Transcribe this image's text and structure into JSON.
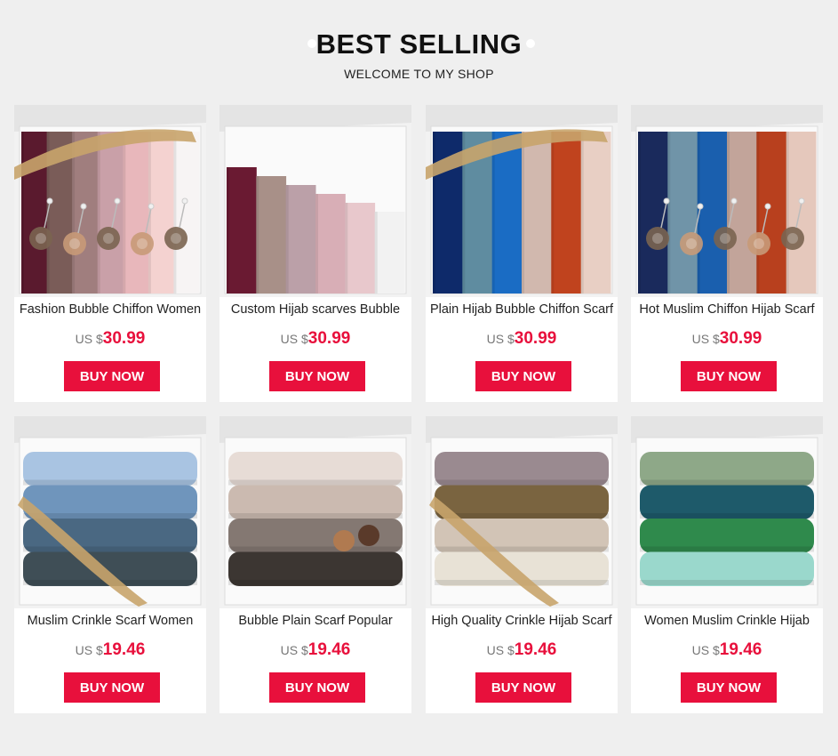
{
  "header": {
    "title": "BEST SELLING",
    "subtitle": "WELCOME TO MY SHOP"
  },
  "products": [
    {
      "name": "Fashion Bubble Chiffon Women",
      "currency": "US $",
      "price": "30.99",
      "buy_label": "BUY NOW",
      "image": "scarf-box-ribbon-roses",
      "colors": [
        "#5a1a2e",
        "#7a5c58",
        "#a07e7e",
        "#c9a0a8",
        "#e8b7bb",
        "#f4d2d0",
        "#f7f4f4"
      ]
    },
    {
      "name": "Custom Hijab scarves Bubble",
      "currency": "US $",
      "price": "30.99",
      "buy_label": "BUY NOW",
      "image": "scarf-box-folded",
      "colors": [
        "#6a1a32",
        "#a89088",
        "#bba0a8",
        "#d8aeb6",
        "#e8c8cc",
        "#f2f2f2"
      ]
    },
    {
      "name": "Plain Hijab Bubble Chiffon Scarf",
      "currency": "US $",
      "price": "30.99",
      "buy_label": "BUY NOW",
      "image": "scarf-box-ribbon",
      "colors": [
        "#0e2a6a",
        "#5f8ca0",
        "#1a6cc4",
        "#d1b8ae",
        "#c0431e",
        "#e8cfc4"
      ]
    },
    {
      "name": "Hot Muslim Chiffon Hijab Scarf",
      "currency": "US $",
      "price": "30.99",
      "buy_label": "BUY NOW",
      "image": "scarf-box-diagonal-roses",
      "colors": [
        "#1a2a5c",
        "#7094a8",
        "#1a5fae",
        "#c2a49a",
        "#b8401e",
        "#e5c8bc"
      ]
    },
    {
      "name": "Muslim Crinkle Scarf Women",
      "currency": "US $",
      "price": "19.46",
      "buy_label": "BUY NOW",
      "image": "crinkle-box-ribbon",
      "colors": [
        "#a9c4e2",
        "#6f95bc",
        "#4a6882",
        "#3f4e56"
      ]
    },
    {
      "name": "Bubble Plain Scarf Popular",
      "currency": "US $",
      "price": "19.46",
      "buy_label": "BUY NOW",
      "image": "crinkle-box-roses",
      "colors": [
        "#e7dcd6",
        "#cbbab0",
        "#847872",
        "#3c3632"
      ]
    },
    {
      "name": "High Quality Crinkle Hijab Scarf",
      "currency": "US $",
      "price": "19.46",
      "buy_label": "BUY NOW",
      "image": "crinkle-box-diagonal",
      "colors": [
        "#9a8a90",
        "#7a6440",
        "#d2c4b6",
        "#e8e2d6"
      ]
    },
    {
      "name": "Women Muslim Crinkle Hijab",
      "currency": "US $",
      "price": "19.46",
      "buy_label": "BUY NOW",
      "image": "crinkle-box-green",
      "colors": [
        "#8ea888",
        "#1e5a6a",
        "#2f8a4c",
        "#9ad8cc"
      ]
    }
  ]
}
